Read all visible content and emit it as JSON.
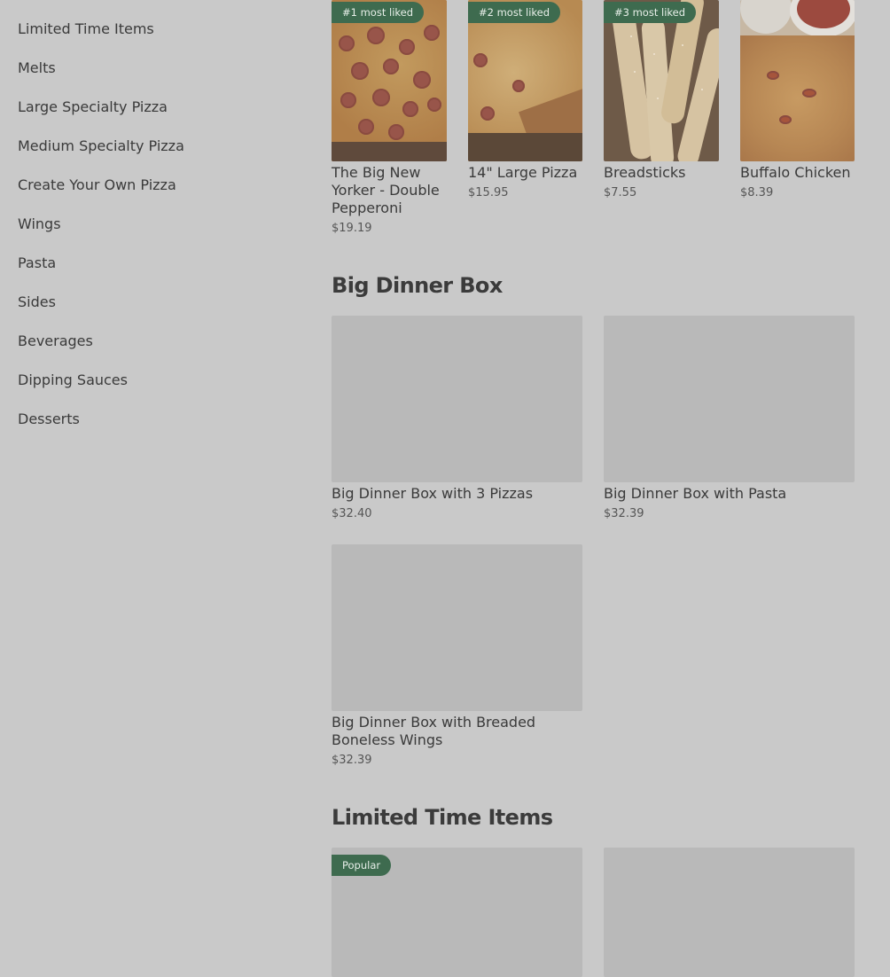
{
  "sidebar": {
    "items": [
      {
        "label": "Limited Time Items"
      },
      {
        "label": "Melts"
      },
      {
        "label": "Large Specialty Pizza"
      },
      {
        "label": "Medium Specialty Pizza"
      },
      {
        "label": "Create Your Own Pizza"
      },
      {
        "label": "Wings"
      },
      {
        "label": "Pasta"
      },
      {
        "label": "Sides"
      },
      {
        "label": "Beverages"
      },
      {
        "label": "Dipping Sauces"
      },
      {
        "label": "Desserts"
      }
    ]
  },
  "most_liked": [
    {
      "badge": "#1 most liked",
      "name_lines": [
        "The Big New",
        "Yorker - Double",
        "Pepperoni"
      ],
      "price": "$19.19",
      "icon": "pepperoni-pizza-image"
    },
    {
      "badge": "#2 most liked",
      "name_lines": [
        "14\" Large Pizza"
      ],
      "price": "$15.95",
      "icon": "cheese-pizza-image"
    },
    {
      "badge": "#3 most liked",
      "name_lines": [
        "Breadsticks"
      ],
      "price": "$7.55",
      "icon": "breadsticks-image"
    },
    {
      "badge": "",
      "name_lines": [
        "Buffalo Chicken"
      ],
      "price": "$8.39",
      "icon": "buffalo-chicken-image"
    }
  ],
  "big_dinner_box": {
    "title": "Big Dinner Box",
    "items": [
      {
        "name_lines": [
          "Big Dinner Box with 3 Pizzas"
        ],
        "price": "$32.40"
      },
      {
        "name_lines": [
          "Big Dinner Box with Pasta"
        ],
        "price": "$32.39"
      },
      {
        "name_lines": [
          "Big Dinner Box with Breaded",
          "Boneless Wings"
        ],
        "price": "$32.39"
      }
    ]
  },
  "limited_time": {
    "title": "Limited Time Items",
    "badge": "Popular"
  },
  "colors": {
    "background": "#c9c9c9",
    "badge_green": "#3e6b4f",
    "placeholder": "#b9b9b9",
    "text": "#3a3a3a"
  }
}
